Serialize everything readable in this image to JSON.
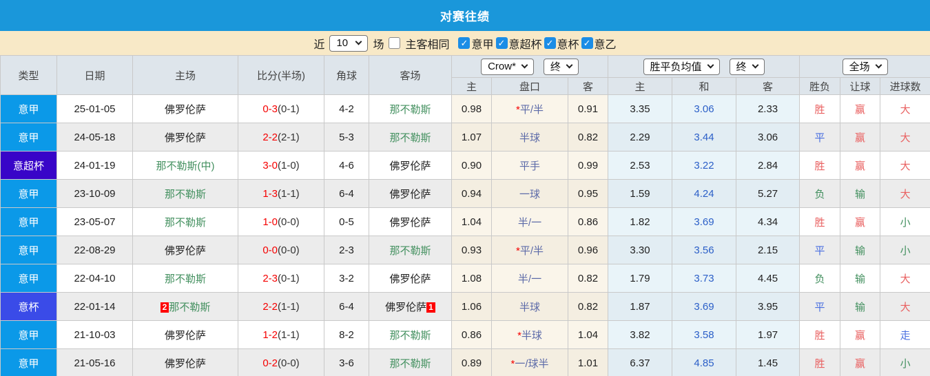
{
  "title": "对赛往绩",
  "filter": {
    "near_label": "近",
    "count_value": "10",
    "games_label": "场",
    "same_venue_label": "主客相同",
    "same_venue_checked": false,
    "check_glyph": "✓",
    "leagues": [
      {
        "label": "意甲",
        "checked": true
      },
      {
        "label": "意超杯",
        "checked": true
      },
      {
        "label": "意杯",
        "checked": true
      },
      {
        "label": "意乙",
        "checked": true
      }
    ]
  },
  "colors": {
    "title_bar": "#1a97da",
    "filter_bar": "#f8e9c7",
    "checkbox_on": "#1b8de6",
    "serie_a_badge": "#0b99e8",
    "super_cup_badge": "#3805c8",
    "cup_badge": "#3a4be8",
    "score_red": "#f50000",
    "team_green": "#43905f",
    "handicap_text": "#5c6aa8",
    "draw_avg_blue": "#2b5fc8"
  },
  "table": {
    "static_headers": [
      "类型",
      "日期",
      "主场",
      "比分(半场)",
      "角球",
      "客场"
    ],
    "group1": {
      "select1": "Crow*",
      "select2": "终"
    },
    "group2": {
      "select1": "胜平负均值",
      "select2": "终"
    },
    "group3": {
      "select": "全场"
    },
    "subheaders": [
      "主",
      "盘口",
      "客",
      "主",
      "和",
      "客",
      "胜负",
      "让球",
      "进球数"
    ],
    "rows": [
      {
        "type": {
          "text": "意甲",
          "cls": "t-seriea"
        },
        "date": "25-01-05",
        "home_card": "",
        "home": {
          "text": "佛罗伦萨",
          "cls": "black"
        },
        "score": "0-3",
        "half": "(0-1)",
        "corners": "4-2",
        "away": {
          "text": "那不勒斯",
          "cls": "green"
        },
        "away_card": "",
        "odds_home": "0.98",
        "star": "*",
        "handicap": "平/半",
        "odds_away": "0.91",
        "avg_home": "3.35",
        "avg_draw": "3.06",
        "avg_away": "2.33",
        "wdl": {
          "text": "胜",
          "cls": "red"
        },
        "hres": {
          "text": "赢",
          "cls": "red"
        },
        "goals": {
          "text": "大",
          "cls": "red"
        }
      },
      {
        "type": {
          "text": "意甲",
          "cls": "t-seriea"
        },
        "date": "24-05-18",
        "home_card": "",
        "home": {
          "text": "佛罗伦萨",
          "cls": "black"
        },
        "score": "2-2",
        "half": "(2-1)",
        "corners": "5-3",
        "away": {
          "text": "那不勒斯",
          "cls": "green"
        },
        "away_card": "",
        "odds_home": "1.07",
        "star": "",
        "handicap": "半球",
        "odds_away": "0.82",
        "avg_home": "2.29",
        "avg_draw": "3.44",
        "avg_away": "3.06",
        "wdl": {
          "text": "平",
          "cls": "blue"
        },
        "hres": {
          "text": "赢",
          "cls": "red"
        },
        "goals": {
          "text": "大",
          "cls": "red"
        }
      },
      {
        "type": {
          "text": "意超杯",
          "cls": "t-supercup"
        },
        "date": "24-01-19",
        "home_card": "",
        "home": {
          "text": "那不勒斯(中)",
          "cls": "green"
        },
        "score": "3-0",
        "half": "(1-0)",
        "corners": "4-6",
        "away": {
          "text": "佛罗伦萨",
          "cls": "black"
        },
        "away_card": "",
        "odds_home": "0.90",
        "star": "",
        "handicap": "平手",
        "odds_away": "0.99",
        "avg_home": "2.53",
        "avg_draw": "3.22",
        "avg_away": "2.84",
        "wdl": {
          "text": "胜",
          "cls": "red"
        },
        "hres": {
          "text": "赢",
          "cls": "red"
        },
        "goals": {
          "text": "大",
          "cls": "red"
        }
      },
      {
        "type": {
          "text": "意甲",
          "cls": "t-seriea"
        },
        "date": "23-10-09",
        "home_card": "",
        "home": {
          "text": "那不勒斯",
          "cls": "green"
        },
        "score": "1-3",
        "half": "(1-1)",
        "corners": "6-4",
        "away": {
          "text": "佛罗伦萨",
          "cls": "black"
        },
        "away_card": "",
        "odds_home": "0.94",
        "star": "",
        "handicap": "一球",
        "odds_away": "0.95",
        "avg_home": "1.59",
        "avg_draw": "4.24",
        "avg_away": "5.27",
        "wdl": {
          "text": "负",
          "cls": "green"
        },
        "hres": {
          "text": "输",
          "cls": "green"
        },
        "goals": {
          "text": "大",
          "cls": "red"
        }
      },
      {
        "type": {
          "text": "意甲",
          "cls": "t-seriea"
        },
        "date": "23-05-07",
        "home_card": "",
        "home": {
          "text": "那不勒斯",
          "cls": "green"
        },
        "score": "1-0",
        "half": "(0-0)",
        "corners": "0-5",
        "away": {
          "text": "佛罗伦萨",
          "cls": "black"
        },
        "away_card": "",
        "odds_home": "1.04",
        "star": "",
        "handicap": "半/一",
        "odds_away": "0.86",
        "avg_home": "1.82",
        "avg_draw": "3.69",
        "avg_away": "4.34",
        "wdl": {
          "text": "胜",
          "cls": "red"
        },
        "hres": {
          "text": "赢",
          "cls": "red"
        },
        "goals": {
          "text": "小",
          "cls": "green"
        }
      },
      {
        "type": {
          "text": "意甲",
          "cls": "t-seriea"
        },
        "date": "22-08-29",
        "home_card": "",
        "home": {
          "text": "佛罗伦萨",
          "cls": "black"
        },
        "score": "0-0",
        "half": "(0-0)",
        "corners": "2-3",
        "away": {
          "text": "那不勒斯",
          "cls": "green"
        },
        "away_card": "",
        "odds_home": "0.93",
        "star": "*",
        "handicap": "平/半",
        "odds_away": "0.96",
        "avg_home": "3.30",
        "avg_draw": "3.56",
        "avg_away": "2.15",
        "wdl": {
          "text": "平",
          "cls": "blue"
        },
        "hres": {
          "text": "输",
          "cls": "green"
        },
        "goals": {
          "text": "小",
          "cls": "green"
        }
      },
      {
        "type": {
          "text": "意甲",
          "cls": "t-seriea"
        },
        "date": "22-04-10",
        "home_card": "",
        "home": {
          "text": "那不勒斯",
          "cls": "green"
        },
        "score": "2-3",
        "half": "(0-1)",
        "corners": "3-2",
        "away": {
          "text": "佛罗伦萨",
          "cls": "black"
        },
        "away_card": "",
        "odds_home": "1.08",
        "star": "",
        "handicap": "半/一",
        "odds_away": "0.82",
        "avg_home": "1.79",
        "avg_draw": "3.73",
        "avg_away": "4.45",
        "wdl": {
          "text": "负",
          "cls": "green"
        },
        "hres": {
          "text": "输",
          "cls": "green"
        },
        "goals": {
          "text": "大",
          "cls": "red"
        }
      },
      {
        "type": {
          "text": "意杯",
          "cls": "t-cup"
        },
        "date": "22-01-14",
        "home_card": "2",
        "home": {
          "text": "那不勒斯",
          "cls": "green"
        },
        "score": "2-2",
        "half": "(1-1)",
        "corners": "6-4",
        "away": {
          "text": "佛罗伦萨",
          "cls": "black"
        },
        "away_card": "1",
        "odds_home": "1.06",
        "star": "",
        "handicap": "半球",
        "odds_away": "0.82",
        "avg_home": "1.87",
        "avg_draw": "3.69",
        "avg_away": "3.95",
        "wdl": {
          "text": "平",
          "cls": "blue"
        },
        "hres": {
          "text": "输",
          "cls": "green"
        },
        "goals": {
          "text": "大",
          "cls": "red"
        }
      },
      {
        "type": {
          "text": "意甲",
          "cls": "t-seriea"
        },
        "date": "21-10-03",
        "home_card": "",
        "home": {
          "text": "佛罗伦萨",
          "cls": "black"
        },
        "score": "1-2",
        "half": "(1-1)",
        "corners": "8-2",
        "away": {
          "text": "那不勒斯",
          "cls": "green"
        },
        "away_card": "",
        "odds_home": "0.86",
        "star": "*",
        "handicap": "半球",
        "odds_away": "1.04",
        "avg_home": "3.82",
        "avg_draw": "3.58",
        "avg_away": "1.97",
        "wdl": {
          "text": "胜",
          "cls": "red"
        },
        "hres": {
          "text": "赢",
          "cls": "red"
        },
        "goals": {
          "text": "走",
          "cls": "blue"
        }
      },
      {
        "type": {
          "text": "意甲",
          "cls": "t-seriea"
        },
        "date": "21-05-16",
        "home_card": "",
        "home": {
          "text": "佛罗伦萨",
          "cls": "black"
        },
        "score": "0-2",
        "half": "(0-0)",
        "corners": "3-6",
        "away": {
          "text": "那不勒斯",
          "cls": "green"
        },
        "away_card": "",
        "odds_home": "0.89",
        "star": "*",
        "handicap": "一/球半",
        "odds_away": "1.01",
        "avg_home": "6.37",
        "avg_draw": "4.85",
        "avg_away": "1.45",
        "wdl": {
          "text": "胜",
          "cls": "red"
        },
        "hres": {
          "text": "赢",
          "cls": "red"
        },
        "goals": {
          "text": "小",
          "cls": "green"
        }
      }
    ]
  }
}
